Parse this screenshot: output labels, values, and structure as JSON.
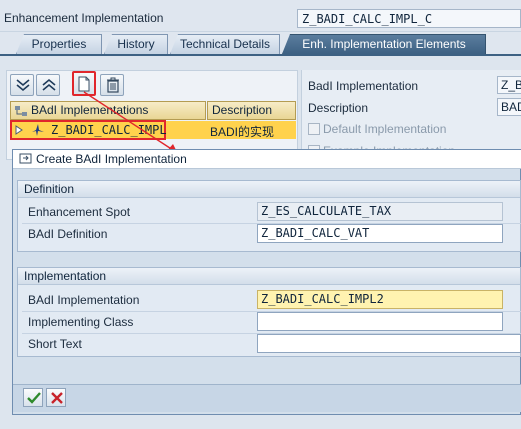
{
  "header": {
    "label": "Enhancement Implementation",
    "value": "Z_BADI_CALC_IMPL_C"
  },
  "tabs": [
    {
      "label": "Properties"
    },
    {
      "label": "History"
    },
    {
      "label": "Technical Details"
    },
    {
      "label": "Enh. Implementation Elements"
    }
  ],
  "tree": {
    "col_impl": "BAdI Implementations",
    "col_desc": "Description",
    "row": {
      "name": "Z_BADI_CALC_IMPL",
      "description": "BADI的实现"
    }
  },
  "details": {
    "badi_impl_label": "BadI Implementation",
    "badi_impl_value": "Z_BA",
    "desc_label": "Description",
    "desc_value": "BAD",
    "default_impl_label": "Default Implementation",
    "example_impl_label": "Example Implementation"
  },
  "dialog": {
    "title": "Create BAdI Implementation",
    "definition": {
      "heading": "Definition",
      "spot_label": "Enhancement Spot",
      "spot_value": "Z_ES_CALCULATE_TAX",
      "badi_def_label": "BAdI Definition",
      "badi_def_value": "Z_BADI_CALC_VAT"
    },
    "implementation": {
      "heading": "Implementation",
      "impl_label": "BAdI Implementation",
      "impl_value": "Z_BADI_CALC_IMPL2",
      "class_label": "Implementing Class",
      "class_value": "",
      "short_text_label": "Short Text",
      "short_text_value": ""
    }
  },
  "colors": {
    "active_tab": "#3d6183",
    "selected_row": "#ffd24d",
    "highlight": "#e0262c",
    "required_field": "#fff3b0"
  }
}
